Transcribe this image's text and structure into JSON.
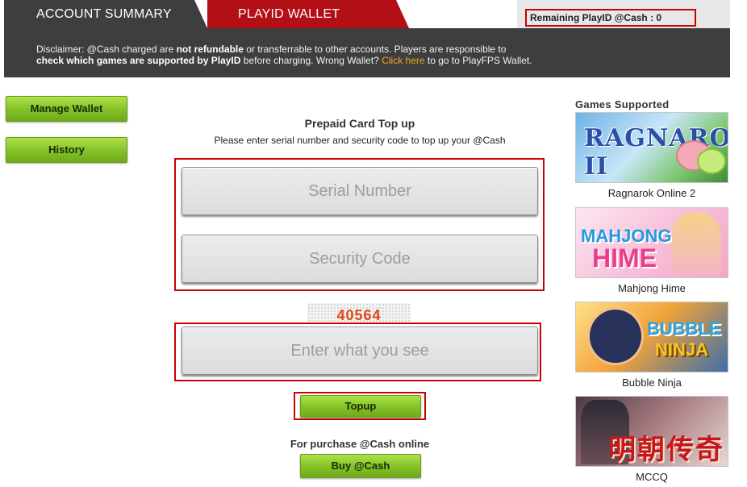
{
  "tabs": {
    "account_summary": "ACCOUNT SUMMARY",
    "playid_wallet": "PLAYID WALLET"
  },
  "remaining": "Remaining PlayID @Cash : 0",
  "disclaimer": {
    "part1": "Disclaimer: @Cash charged are ",
    "bold1": "not refundable",
    "part2": " or transferrable to other accounts. Players are responsible to",
    "bold2": "check which games are supported by PlayID",
    "part3": " before charging. Wrong Wallet? ",
    "link": "Click here",
    "part4": " to go to PlayFPS Wallet."
  },
  "sidebar": {
    "manage_wallet": "Manage Wallet",
    "history": "History"
  },
  "form": {
    "title": "Prepaid Card Top up",
    "subtitle": "Please enter serial number and security code to top up your @Cash",
    "serial_placeholder": "Serial Number",
    "security_placeholder": "Security Code",
    "captcha_code": "40564",
    "captcha_placeholder": "Enter what you see",
    "topup_label": "Topup",
    "purchase_label": "For purchase @Cash online",
    "buy_label": "Buy @Cash"
  },
  "games": {
    "title": "Games Supported",
    "items": [
      {
        "name": "Ragnarok Online 2",
        "logo": "RAGNAROK II"
      },
      {
        "name": "Mahjong Hime",
        "logo1": "MAHJONG",
        "logo2": "HIME"
      },
      {
        "name": "Bubble Ninja",
        "logo1": "BUBBLE",
        "logo2": "NINJA"
      },
      {
        "name": "MCCQ",
        "logo": "明朝传奇"
      }
    ]
  },
  "colors": {
    "dark_bar": "#3e3e3e",
    "brand_red": "#b30f16",
    "highlight_red": "#cc0000",
    "button_green": "#86c42a",
    "link_orange": "#f5a623",
    "captcha_orange": "#e0461a"
  }
}
